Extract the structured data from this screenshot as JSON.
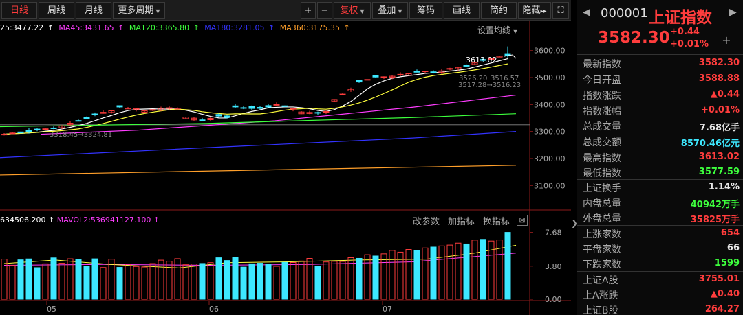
{
  "toolbar": {
    "tabs": [
      "日线",
      "周线",
      "月线",
      "更多周期"
    ],
    "active_tab": "日线",
    "zoom_in": "+",
    "zoom_out": "−",
    "fuquan": "复权",
    "overlay": "叠加",
    "chips": "筹码",
    "draw": "画线",
    "brief": "简约",
    "hide": "隐藏",
    "hide_arrows": "▸▸",
    "expand": "⛶"
  },
  "ma_legend": [
    {
      "text": "25:3477.22",
      "color": "#ffffff"
    },
    {
      "text": "MA45:3431.65",
      "color": "#ff3dff"
    },
    {
      "text": "MA120:3365.80",
      "color": "#3dff3d"
    },
    {
      "text": "MA180:3281.05",
      "color": "#3333ff"
    },
    {
      "text": "MA360:3175.35",
      "color": "#ff9f2a"
    }
  ],
  "settings_label": "设置均线",
  "price_axis": [
    "3600.00",
    "3500.00",
    "3400.00",
    "3300.00",
    "3200.00",
    "3100.00"
  ],
  "annotations": {
    "high": "3613.02",
    "mid1": "3526.20",
    "mid2": "3516.57",
    "range": "3517.28→3516.23",
    "low": "3318.45→3324.81"
  },
  "vol_legend": [
    {
      "text": "634506.200",
      "color": "#ffffff"
    },
    {
      "text": "MAVOL2:536941127.100",
      "color": "#ff3dff"
    }
  ],
  "vol_tools": [
    "改参数",
    "加指标",
    "换指标"
  ],
  "vol_close": "⊠",
  "vol_axis": [
    "7.68",
    "3.80",
    "0.00"
  ],
  "months": [
    "05",
    "06",
    "07"
  ],
  "chart_data": {
    "type": "candlestick",
    "price_ylim": [
      3060,
      3640
    ],
    "volume_ylim": [
      0,
      8.2
    ],
    "volume_unit": "亿手"
  },
  "info": {
    "nav_left": "◀",
    "code": "000001",
    "name": "上证指数",
    "nav_right": "▶",
    "price": "3582.30",
    "change": "+0.44",
    "pct": "+0.01%",
    "plus": "+",
    "rows": [
      {
        "label": "最新指数",
        "value": "3582.30",
        "color": "#ff3d3d"
      },
      {
        "label": "今日开盘",
        "value": "3588.88",
        "color": "#ff3d3d"
      },
      {
        "label": "指数涨跌",
        "value": "▲0.44",
        "color": "#ff3d3d"
      },
      {
        "label": "指数涨幅",
        "value": "+0.01%",
        "color": "#ff3d3d"
      },
      {
        "label": "总成交量",
        "value": "7.68亿手",
        "color": "#e8e8e8"
      },
      {
        "label": "总成交额",
        "value": "8570.46亿元",
        "color": "#3de8ff"
      },
      {
        "label": "最高指数",
        "value": "3613.02",
        "color": "#ff3d3d"
      },
      {
        "label": "最低指数",
        "value": "3577.59",
        "color": "#3dff3d"
      },
      {
        "label": "上证换手",
        "value": "1.14%",
        "color": "#e8e8e8"
      },
      {
        "label": "内盘总量",
        "value": "40942万手",
        "color": "#3dff3d"
      },
      {
        "label": "外盘总量",
        "value": "35825万手",
        "color": "#ff3d3d"
      },
      {
        "label": "上涨家数",
        "value": "654",
        "color": "#ff3d3d"
      },
      {
        "label": "平盘家数",
        "value": "66",
        "color": "#e8e8e8"
      },
      {
        "label": "下跌家数",
        "value": "1599",
        "color": "#3dff3d"
      },
      {
        "label": "上证A股",
        "value": "3755.01",
        "color": "#ff3d3d"
      },
      {
        "label": "上A涨跌",
        "value": "▲0.40",
        "color": "#ff3d3d"
      },
      {
        "label": "上证B股",
        "value": "264.27",
        "color": "#ff3d3d"
      }
    ]
  }
}
